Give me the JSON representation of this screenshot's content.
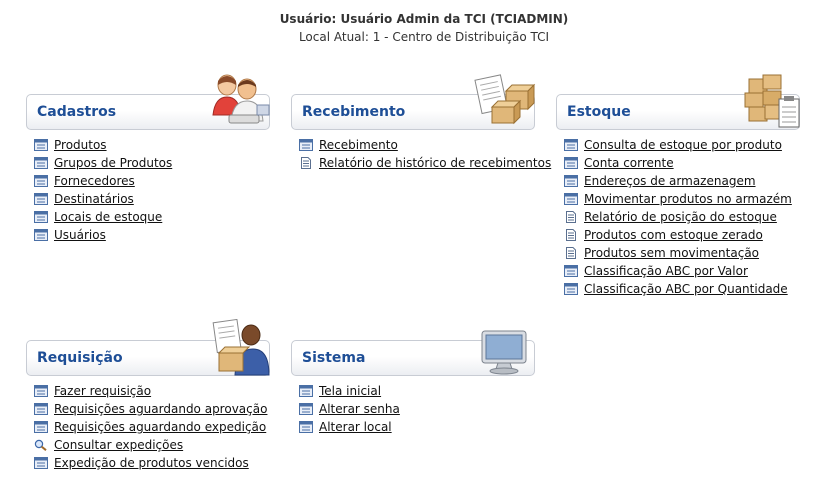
{
  "header": {
    "user_line": "Usuário: Usuário Admin da TCI (TCIADMIN)",
    "local_line": "Local Atual: 1 - Centro de Distribuição TCI"
  },
  "sections": {
    "cadastros": {
      "title": "Cadastros",
      "art_icon": "people-icon",
      "items": [
        {
          "label": "Produtos",
          "icon": "form-icon"
        },
        {
          "label": "Grupos de Produtos",
          "icon": "form-icon"
        },
        {
          "label": "Fornecedores",
          "icon": "form-icon"
        },
        {
          "label": "Destinatários",
          "icon": "form-icon"
        },
        {
          "label": "Locais de estoque",
          "icon": "form-icon"
        },
        {
          "label": "Usuários",
          "icon": "form-icon"
        }
      ]
    },
    "recebimento": {
      "title": "Recebimento",
      "art_icon": "documents-boxes-icon",
      "items": [
        {
          "label": "Recebimento",
          "icon": "form-icon"
        },
        {
          "label": "Relatório de histórico de recebimentos",
          "icon": "report-icon"
        }
      ]
    },
    "estoque": {
      "title": "Estoque",
      "art_icon": "boxes-clipboard-icon",
      "items": [
        {
          "label": "Consulta de estoque por produto",
          "icon": "form-icon"
        },
        {
          "label": "Conta corrente",
          "icon": "form-icon"
        },
        {
          "label": "Endereços de armazenagem",
          "icon": "form-icon"
        },
        {
          "label": "Movimentar produtos no armazém",
          "icon": "form-icon"
        },
        {
          "label": "Relatório de posição do estoque",
          "icon": "report-icon"
        },
        {
          "label": "Produtos com estoque zerado",
          "icon": "report-icon"
        },
        {
          "label": "Produtos sem movimentação",
          "icon": "report-icon"
        },
        {
          "label": "Classificação ABC por Valor",
          "icon": "form-icon"
        },
        {
          "label": "Classificação ABC por Quantidade",
          "icon": "form-icon"
        }
      ]
    },
    "requisicao": {
      "title": "Requisição",
      "art_icon": "person-box-icon",
      "items": [
        {
          "label": "Fazer requisição",
          "icon": "form-icon"
        },
        {
          "label": "Requisições aguardando aprovação",
          "icon": "form-icon"
        },
        {
          "label": "Requisições aguardando expedição",
          "icon": "form-icon"
        },
        {
          "label": "Consultar expedições",
          "icon": "search-icon"
        },
        {
          "label": "Expedição de produtos vencidos",
          "icon": "form-icon"
        }
      ]
    },
    "sistema": {
      "title": "Sistema",
      "art_icon": "monitor-icon",
      "items": [
        {
          "label": "Tela inicial",
          "icon": "form-icon"
        },
        {
          "label": "Alterar senha",
          "icon": "form-icon"
        },
        {
          "label": "Alterar local",
          "icon": "form-icon"
        }
      ]
    }
  },
  "colors": {
    "title_blue": "#1e4e96",
    "panel_border": "#c8ccd4"
  }
}
